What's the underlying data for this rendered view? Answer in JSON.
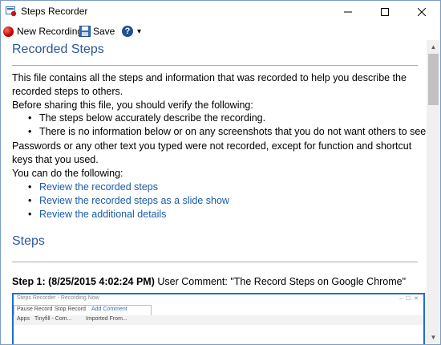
{
  "window": {
    "title": "Steps Recorder",
    "controls": {
      "minimize": "–",
      "maximize": "☐",
      "close": "✕"
    }
  },
  "toolbar": {
    "new_recording": "New Recording",
    "save": "Save",
    "help_icon": "?",
    "dropdown": "▾"
  },
  "recorded_steps": {
    "heading": "Recorded Steps",
    "intro": "This file contains all the steps and information that was recorded to help you describe the recorded steps to others.",
    "before_sharing": "Before sharing this file, you should verify the following:",
    "checks": [
      "The steps below accurately describe the recording.",
      "There is no information below or on any screenshots that you do not want others to see."
    ],
    "passwords_note": "Passwords or any other text you typed were not recorded, except for function and shortcut keys that you used.",
    "can_do": "You can do the following:",
    "links": [
      "Review the recorded steps",
      "Review the recorded steps as a slide show",
      "Review the additional details"
    ]
  },
  "steps": {
    "heading": "Steps",
    "step1": {
      "label": "Step 1: (8/25/2015 4:02:24 PM)",
      "comment": "User Comment: \"The Record Steps on Google Chrome\""
    }
  },
  "screenshot": {
    "title": "Steps Recorder - Recording Now",
    "pause": "Pause Record",
    "stop": "Stop Record",
    "add_comment": "Add Comment",
    "bookmarks": [
      "Apps",
      "Tinyfill - Com...",
      "Imported From..."
    ]
  },
  "colors": {
    "heading": "#2b579a",
    "link": "#1a5ba8",
    "frame": "#1c6fd4"
  }
}
